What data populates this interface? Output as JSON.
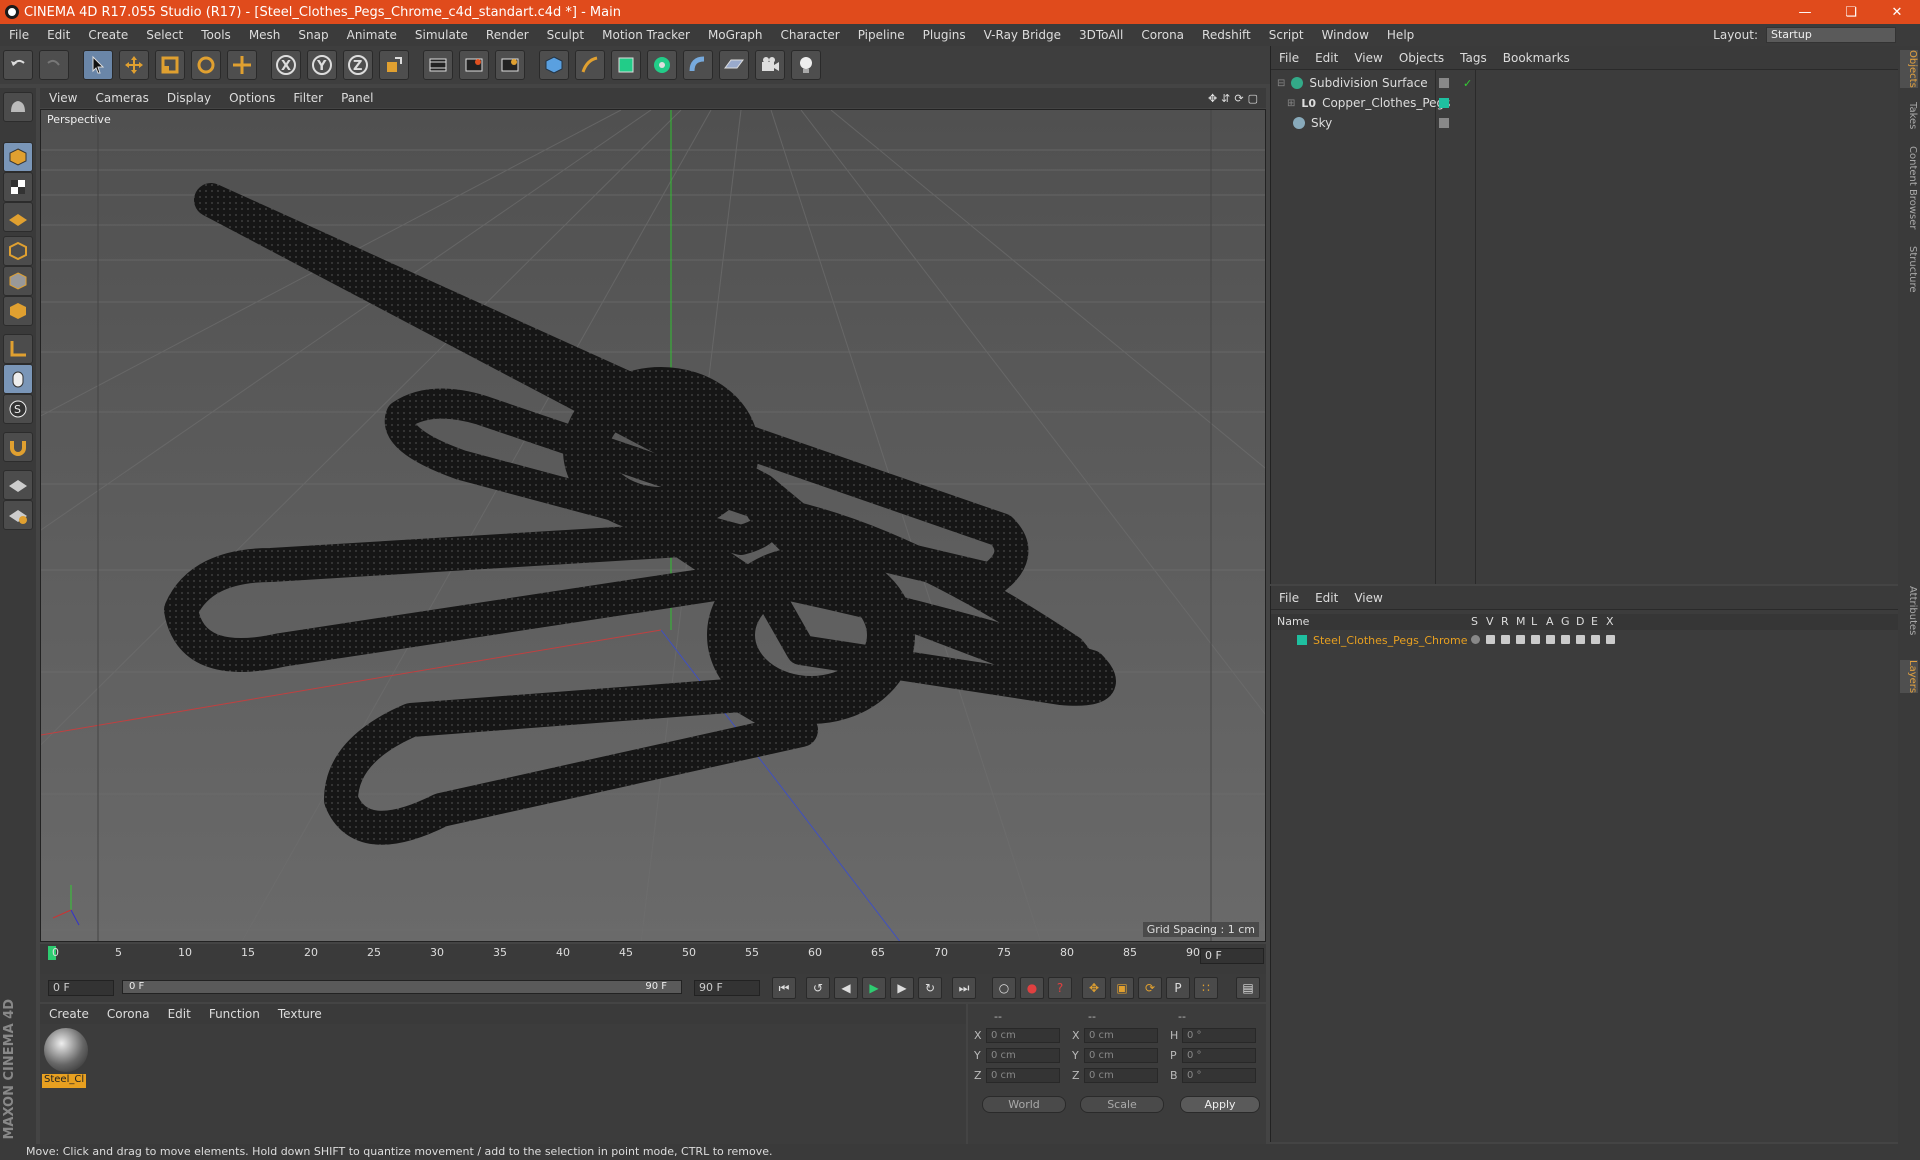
{
  "window": {
    "title": "CINEMA 4D R17.055 Studio (R17) - [Steel_Clothes_Pegs_Chrome_c4d_standart.c4d *] - Main"
  },
  "menu": [
    "File",
    "Edit",
    "Create",
    "Select",
    "Tools",
    "Mesh",
    "Snap",
    "Animate",
    "Simulate",
    "Render",
    "Sculpt",
    "Motion Tracker",
    "MoGraph",
    "Character",
    "Pipeline",
    "Plugins",
    "V-Ray Bridge",
    "3DToAll",
    "Corona",
    "Redshift",
    "Script",
    "Window",
    "Help"
  ],
  "layout": {
    "label": "Layout:",
    "value": "Startup"
  },
  "toolbar_icons": [
    "undo-icon",
    "redo-icon",
    "select-arrow-icon",
    "move-icon",
    "scale-icon",
    "rotate-icon",
    "move-plus-icon",
    "x-axis-icon",
    "y-axis-icon",
    "z-axis-icon",
    "coordinate-system-icon",
    "render-view-icon",
    "render-picture-viewer-icon",
    "render-settings-icon",
    "cube-icon",
    "pen-icon",
    "subdivision-icon",
    "mograph-cloner-icon",
    "deformer-icon",
    "floor-icon",
    "camera-icon",
    "light-icon"
  ],
  "viewport": {
    "menu": [
      "View",
      "Cameras",
      "Display",
      "Options",
      "Filter",
      "Panel"
    ],
    "label": "Perspective",
    "grid_spacing": "Grid Spacing : 1 cm"
  },
  "timeline": {
    "ticks": [
      "0",
      "5",
      "10",
      "15",
      "20",
      "25",
      "30",
      "35",
      "40",
      "45",
      "50",
      "55",
      "60",
      "65",
      "70",
      "75",
      "80",
      "85",
      "90"
    ],
    "current_frame": "0 F"
  },
  "transport": {
    "start": "0 F",
    "slider_start": "0 F",
    "slider_end": "90 F",
    "end": "90 F"
  },
  "material": {
    "menu": [
      "Create",
      "Corona",
      "Edit",
      "Function",
      "Texture"
    ],
    "name": "Steel_Cl"
  },
  "coords": {
    "header": [
      "--",
      "--",
      "--"
    ],
    "rows": [
      {
        "a": "X",
        "av": "0 cm",
        "b": "X",
        "bv": "0 cm",
        "c": "H",
        "cv": "0 °"
      },
      {
        "a": "Y",
        "av": "0 cm",
        "b": "Y",
        "bv": "0 cm",
        "c": "P",
        "cv": "0 °"
      },
      {
        "a": "Z",
        "av": "0 cm",
        "b": "Z",
        "bv": "0 cm",
        "c": "B",
        "cv": "0 °"
      }
    ],
    "world": "World",
    "scale": "Scale",
    "apply": "Apply"
  },
  "objects": {
    "menu": [
      "File",
      "Edit",
      "View",
      "Objects",
      "Tags",
      "Bookmarks"
    ],
    "items": [
      {
        "name": "Subdivision Surface"
      },
      {
        "name": "Copper_Clothes_Pegs"
      },
      {
        "name": "Sky"
      }
    ]
  },
  "layers": {
    "menu": [
      "File",
      "Edit",
      "View"
    ],
    "header_name": "Name",
    "header_cols": [
      "S",
      "V",
      "R",
      "M",
      "L",
      "A",
      "G",
      "D",
      "E",
      "X"
    ],
    "item": "Steel_Clothes_Pegs_Chrome"
  },
  "right_tabs": [
    "Objects",
    "Takes",
    "Content Browser",
    "Structure",
    "Attributes",
    "Layers"
  ],
  "brand": "MAXON CINEMA 4D",
  "status": "Move: Click and drag to move elements. Hold down SHIFT to quantize movement / add to the selection in point mode, CTRL to remove.",
  "colors": {
    "titlebar": "#e04b1c",
    "accent": "#e8a020",
    "layer": "#1fc0a0"
  }
}
